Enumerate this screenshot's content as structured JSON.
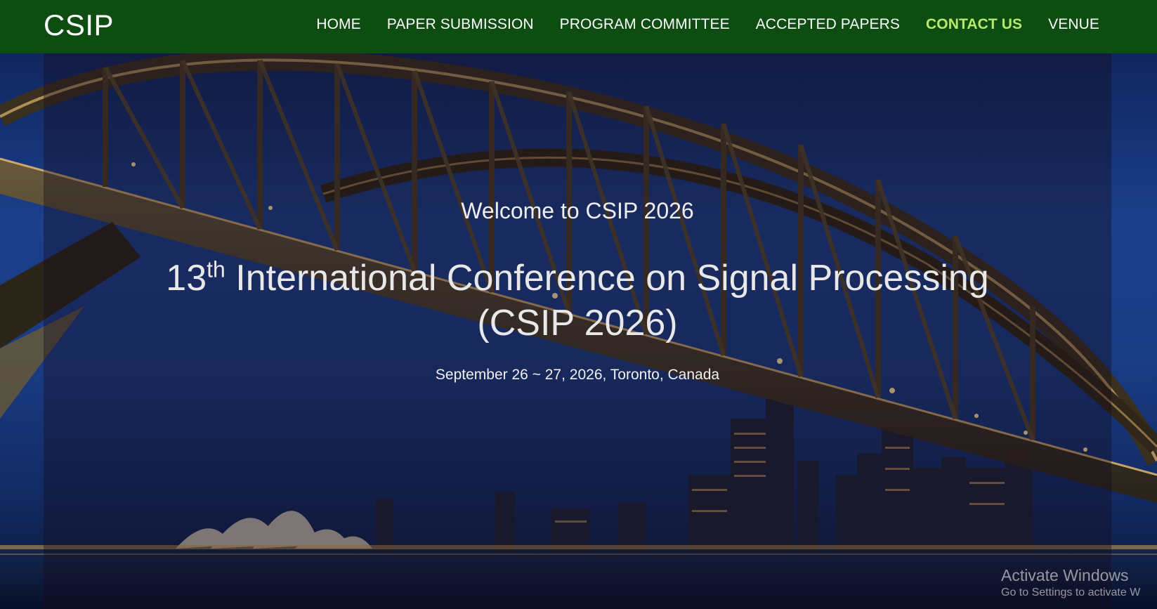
{
  "navbar": {
    "brand": "CSIP",
    "items": [
      {
        "label": "HOME",
        "active": false
      },
      {
        "label": "PAPER SUBMISSION",
        "active": false
      },
      {
        "label": "PROGRAM COMMITTEE",
        "active": false
      },
      {
        "label": "ACCEPTED PAPERS",
        "active": false
      },
      {
        "label": "CONTACT US",
        "active": true
      },
      {
        "label": "VENUE",
        "active": false
      }
    ]
  },
  "hero": {
    "welcome": "Welcome to CSIP 2026",
    "title_ordinal": "13",
    "title_suffix": "th",
    "title_line1": " International Conference on Signal Processing",
    "title_line2": "(CSIP 2026)",
    "date_location": "September 26 ~ 27, 2026, Toronto, Canada",
    "background_image": "night-harbour-bridge-city-skyline"
  },
  "os_watermark": {
    "title": "Activate Windows",
    "subtitle": "Go to Settings to activate W"
  },
  "colors": {
    "navbar_bg": "#0d4d11",
    "nav_active": "#b8e86a",
    "nav_text": "#ffffff"
  }
}
